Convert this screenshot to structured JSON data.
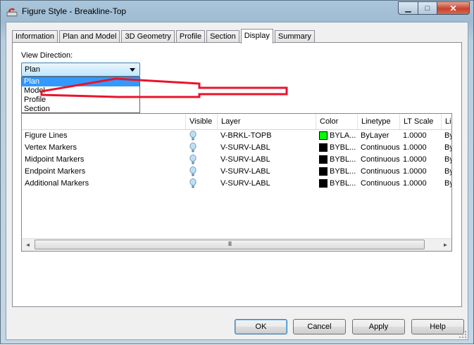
{
  "window": {
    "title": "Figure Style - Breakline-Top",
    "minimize_glyph": "▁",
    "maximize_glyph": "□",
    "close_glyph": "✕"
  },
  "tabs": [
    {
      "label": "Information",
      "active": false
    },
    {
      "label": "Plan and Model",
      "active": false
    },
    {
      "label": "3D Geometry",
      "active": false
    },
    {
      "label": "Profile",
      "active": false
    },
    {
      "label": "Section",
      "active": false
    },
    {
      "label": "Display",
      "active": true
    },
    {
      "label": "Summary",
      "active": false
    }
  ],
  "view_direction": {
    "label": "View Direction:",
    "selected": "Plan",
    "options": [
      "Plan",
      "Model",
      "Profile",
      "Section"
    ]
  },
  "table": {
    "columns": [
      "Visible",
      "Layer",
      "Color",
      "Linetype",
      "LT Scale",
      "Line"
    ],
    "rows": [
      {
        "component": "Figure Lines",
        "layer": "V-BRKL-TOPB",
        "color_text": "BYLA...",
        "swatch": "#00ff00",
        "linetype": "ByLayer",
        "lt_scale": "1.0000",
        "lineweight": "ByBlo"
      },
      {
        "component": "Vertex Markers",
        "layer": "V-SURV-LABL",
        "color_text": "BYBL...",
        "swatch": "#000000",
        "linetype": "Continuous",
        "lt_scale": "1.0000",
        "lineweight": "ByBlo"
      },
      {
        "component": "Midpoint Markers",
        "layer": "V-SURV-LABL",
        "color_text": "BYBL...",
        "swatch": "#000000",
        "linetype": "Continuous",
        "lt_scale": "1.0000",
        "lineweight": "ByBlo"
      },
      {
        "component": "Endpoint Markers",
        "layer": "V-SURV-LABL",
        "color_text": "BYBL...",
        "swatch": "#000000",
        "linetype": "Continuous",
        "lt_scale": "1.0000",
        "lineweight": "ByBlo"
      },
      {
        "component": "Additional Markers",
        "layer": "V-SURV-LABL",
        "color_text": "BYBL...",
        "swatch": "#000000",
        "linetype": "Continuous",
        "lt_scale": "1.0000",
        "lineweight": "ByBlo"
      }
    ]
  },
  "scrollbar": {
    "left_glyph": "◄",
    "right_glyph": "►",
    "thumb_grip": "III"
  },
  "buttons": {
    "ok": "OK",
    "cancel": "Cancel",
    "apply": "Apply",
    "help": "Help"
  },
  "colors": {
    "annotation_arrow": "#e8142b",
    "selection": "#3399ff"
  }
}
